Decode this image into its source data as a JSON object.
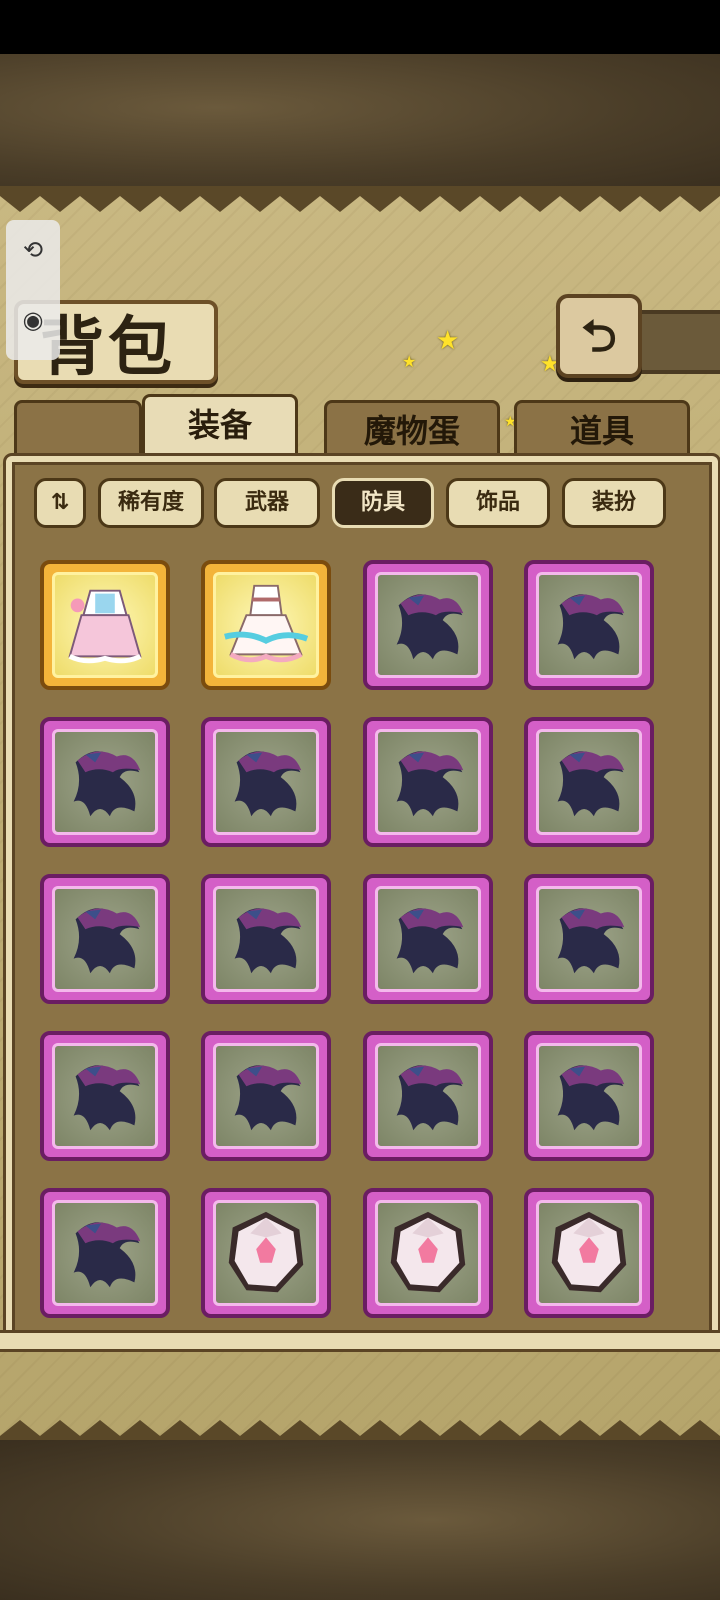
{
  "title": "背包",
  "main_tabs": [
    {
      "label": "装备",
      "active": true
    },
    {
      "label": "魔物蛋",
      "active": false
    },
    {
      "label": "道具",
      "active": false
    }
  ],
  "filters": [
    {
      "label": "稀有度",
      "active": false
    },
    {
      "label": "武器",
      "active": false
    },
    {
      "label": "防具",
      "active": true
    },
    {
      "label": "饰品",
      "active": false
    },
    {
      "label": "装扮",
      "active": false
    }
  ],
  "back_icon": "back-arrow-icon",
  "items": [
    {
      "rarity": "gold",
      "kind": "maid-outfit"
    },
    {
      "rarity": "gold",
      "kind": "white-dress"
    },
    {
      "rarity": "pink",
      "kind": "dark-cloak"
    },
    {
      "rarity": "pink",
      "kind": "dark-cloak"
    },
    {
      "rarity": "pink",
      "kind": "dark-cloak"
    },
    {
      "rarity": "pink",
      "kind": "dark-cloak"
    },
    {
      "rarity": "pink",
      "kind": "dark-cloak"
    },
    {
      "rarity": "pink",
      "kind": "dark-cloak"
    },
    {
      "rarity": "pink",
      "kind": "dark-cloak"
    },
    {
      "rarity": "pink",
      "kind": "dark-cloak"
    },
    {
      "rarity": "pink",
      "kind": "dark-cloak"
    },
    {
      "rarity": "pink",
      "kind": "dark-cloak"
    },
    {
      "rarity": "pink",
      "kind": "dark-cloak"
    },
    {
      "rarity": "pink",
      "kind": "dark-cloak"
    },
    {
      "rarity": "pink",
      "kind": "dark-cloak"
    },
    {
      "rarity": "pink",
      "kind": "dark-cloak"
    },
    {
      "rarity": "pink",
      "kind": "dark-cloak"
    },
    {
      "rarity": "pink",
      "kind": "pink-gem-shield"
    },
    {
      "rarity": "pink",
      "kind": "pink-gem-shield"
    },
    {
      "rarity": "pink",
      "kind": "pink-gem-shield"
    }
  ],
  "colors": {
    "rarity_gold": "#f3b43a",
    "rarity_pink": "#d45fc7",
    "panel": "#8b7346",
    "parchment": "#e9dcb3"
  }
}
